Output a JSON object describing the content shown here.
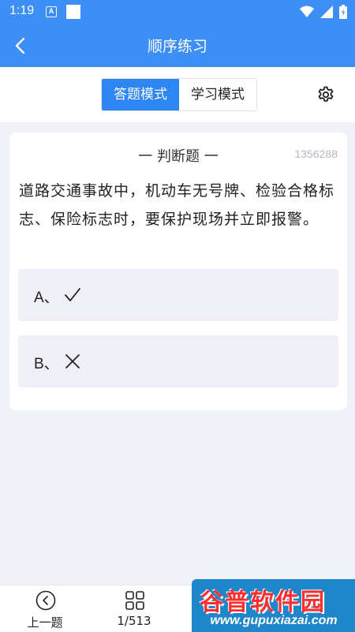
{
  "status_bar": {
    "time": "1:19",
    "badge_letter": "A"
  },
  "header": {
    "title": "顺序练习"
  },
  "mode_tabs": [
    {
      "label": "答题模式",
      "active": true
    },
    {
      "label": "学习模式",
      "active": false
    }
  ],
  "question": {
    "type": "一 判断题 一",
    "id": "1356288",
    "text": "道路交通事故中，机动车无号牌、检验合格标志、保险标志时，要保护现场并立即报警。",
    "options": [
      {
        "label": "A、",
        "icon": "check-icon"
      },
      {
        "label": "B、",
        "icon": "cross-icon"
      }
    ]
  },
  "bottom_nav": {
    "prev_label": "上一题",
    "progress_label": "1/513"
  },
  "watermark": {
    "logo_text": "谷普软件园",
    "url": "www.gupuxiazai.com"
  },
  "colors": {
    "primary": "#3d8ef5",
    "tab_active": "#2e86f2",
    "background": "#f0f2f7",
    "option_bg": "#eef0f5"
  }
}
